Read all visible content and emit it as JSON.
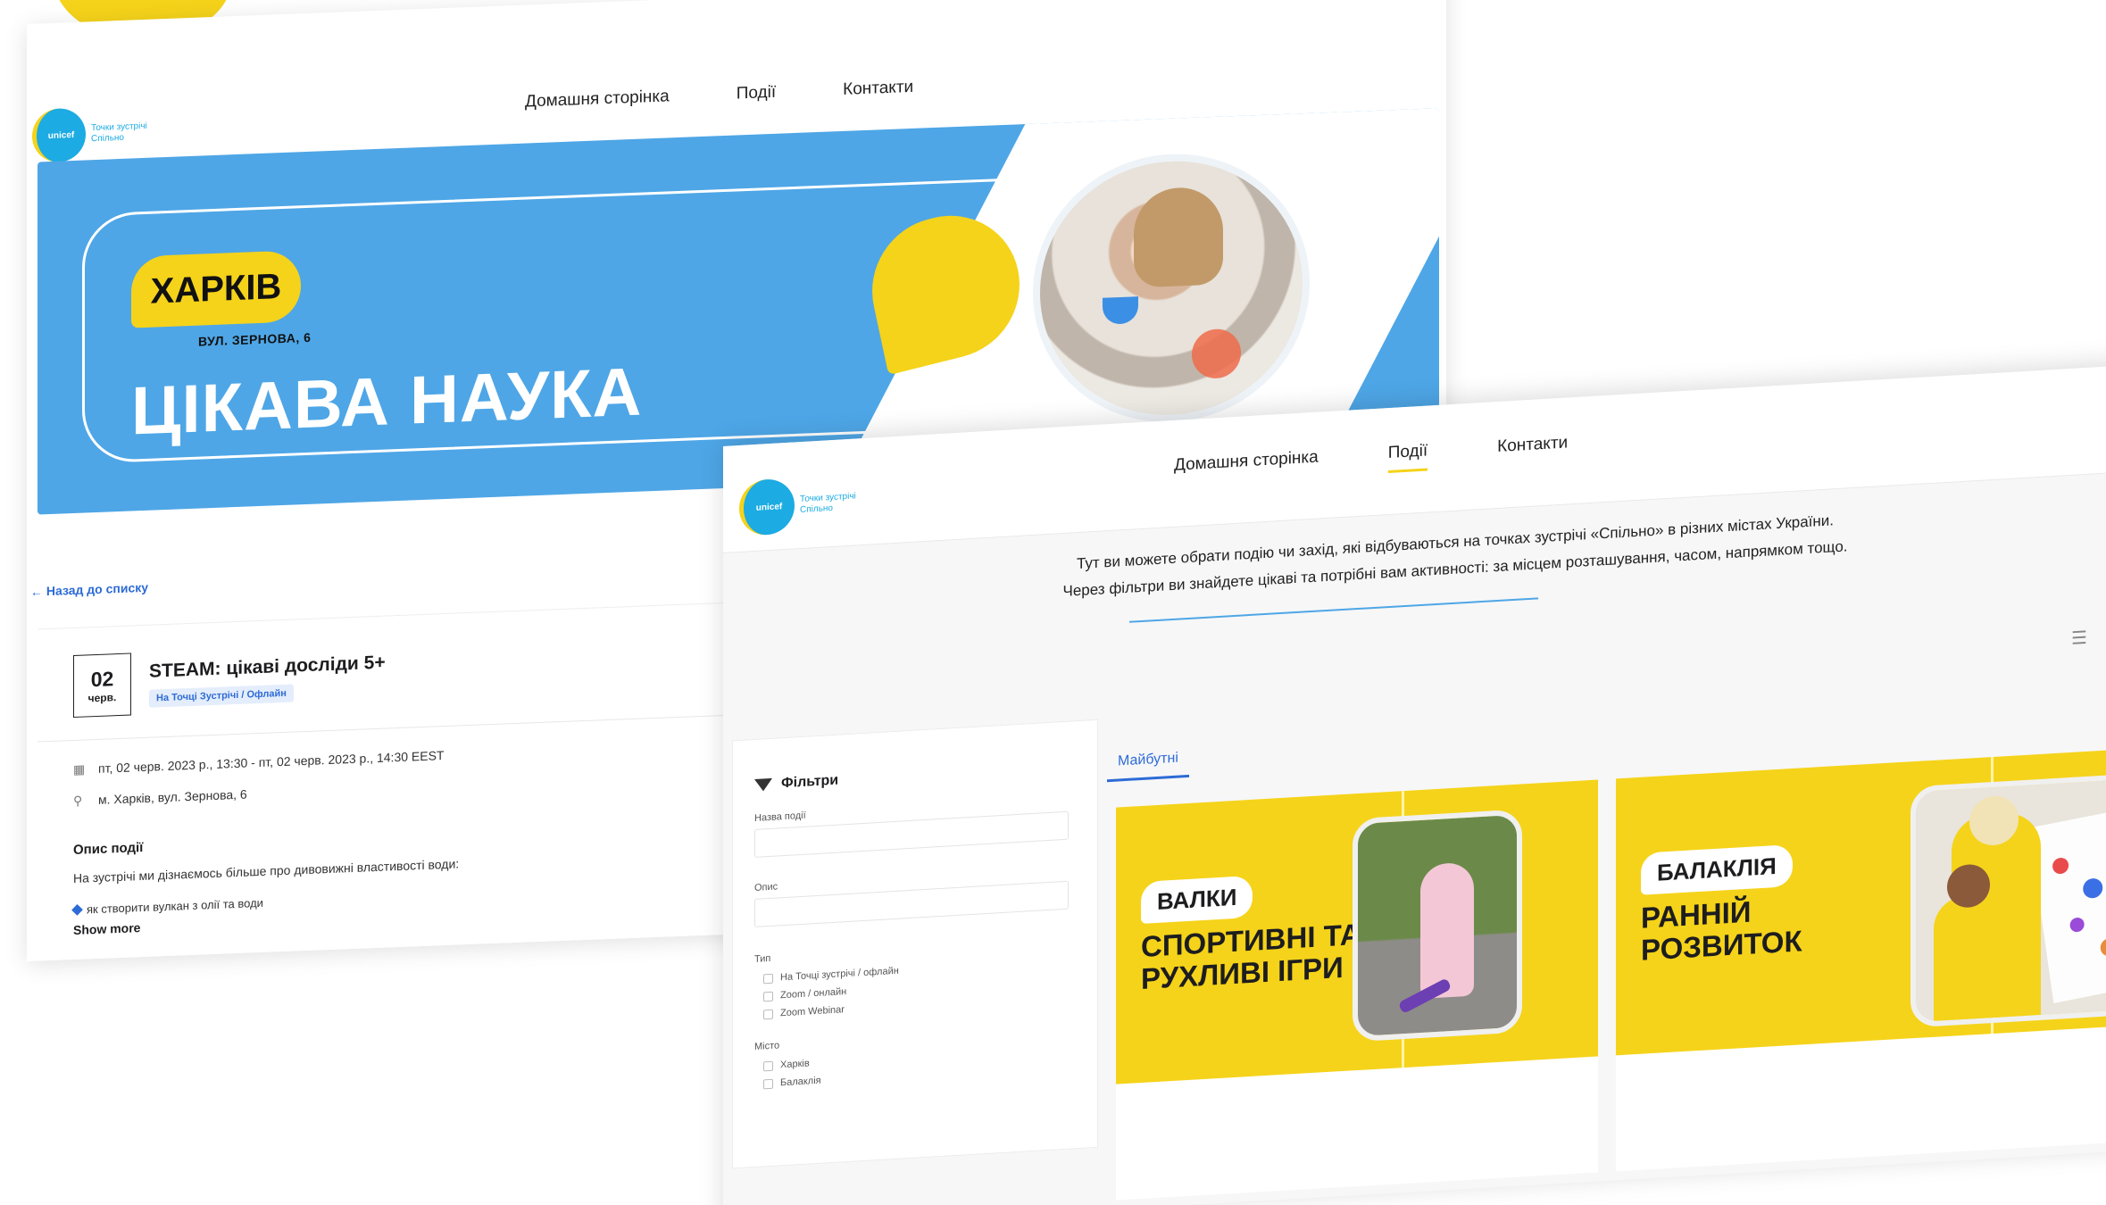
{
  "nav": {
    "home": "Домашня сторінка",
    "events": "Події",
    "contacts": "Контакти"
  },
  "logo": {
    "brand": "unicef",
    "line1": "Точки зустрічі",
    "line2": "Спільно"
  },
  "banner": {
    "city": "ХАРКІВ",
    "address": "ВУЛ. ЗЕРНОВА, 6",
    "title": "ЦІКАВА НАУКА"
  },
  "detail": {
    "back_link": "← Назад до списку",
    "date_day": "02",
    "date_month": "черв.",
    "title": "STEAM: цікаві досліди 5+",
    "tag": "На Точці Зустрічі / Офлайн",
    "datetime": "пт, 02 черв. 2023 р., 13:30 - пт, 02 черв. 2023 р., 14:30 EEST",
    "location": "м. Харків, вул. Зернова, 6",
    "desc_title": "Опис події",
    "desc_text": "На зустрічі ми дізнаємось більше про дивовижні властивості води:",
    "desc_bullet": "як створити вулкан з олії та води",
    "show_more": "Show more"
  },
  "events_page": {
    "intro_line1": "Тут ви можете обрати подію чи захід, які відбуваються на точках зустрічі «Спільно» в різних містах України.",
    "intro_line2": "Через фільтри ви знайдете цікаві та потрібні вам активності: за місцем розташування, часом, напрямком тощо.",
    "filters": {
      "title": "Фільтри",
      "name_label": "Назва події",
      "desc_label": "Опис",
      "type_label": "Тип",
      "types": [
        "На Точці зустрічі / офлайн",
        "Zoom / онлайн",
        "Zoom Webinar"
      ],
      "city_label": "Місто",
      "cities": [
        "Харків",
        "Балаклія"
      ]
    },
    "tab_future": "Майбутні",
    "cards": [
      {
        "city": "ВАЛКИ",
        "title": "СПОРТИВНІ ТА РУХЛИВІ ІГРИ"
      },
      {
        "city": "БАЛАКЛІЯ",
        "title": "РАННІЙ РОЗВИТОК"
      }
    ]
  },
  "colors": {
    "blue": "#4ea6e6",
    "yellow": "#f5d31a",
    "link": "#2d6bd6"
  },
  "icons": [
    "calendar-icon",
    "location-pin-icon",
    "funnel-icon",
    "list-view-icon",
    "arrow-left-icon"
  ]
}
